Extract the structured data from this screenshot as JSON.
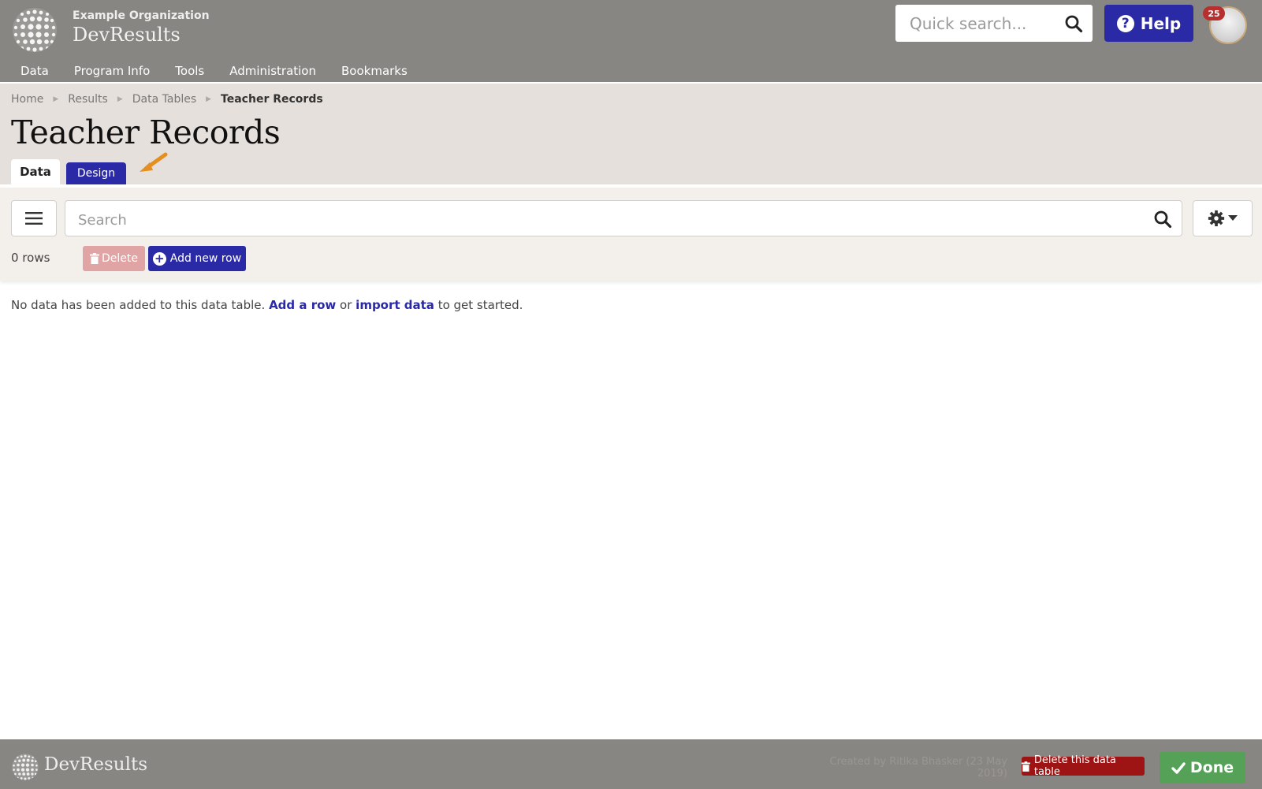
{
  "header": {
    "org_name": "Example Organization",
    "app_name": "DevResults",
    "quick_search": {
      "placeholder": "Quick search...",
      "value": ""
    },
    "help_label": "Help",
    "notification_count": "25"
  },
  "nav": {
    "items": [
      "Data",
      "Program Info",
      "Tools",
      "Administration",
      "Bookmarks"
    ]
  },
  "breadcrumb": {
    "items": [
      "Home",
      "Results",
      "Data Tables"
    ],
    "current": "Teacher Records"
  },
  "page": {
    "title": "Teacher Records",
    "tabs": [
      {
        "label": "Data",
        "active": true
      },
      {
        "label": "Design",
        "active": false
      }
    ]
  },
  "toolbar": {
    "search": {
      "placeholder": "Search",
      "value": ""
    },
    "row_count": "0 rows",
    "delete_label": "Delete",
    "add_row_label": "Add new row"
  },
  "empty_state": {
    "text_before": "No data has been added to this data table. ",
    "add_link": "Add a row",
    "text_middle": " or ",
    "import_link": "import data",
    "text_after": " to get started."
  },
  "footer": {
    "brand": "DevResults",
    "created_by": "Created by Ritika Bhasker (23 May 2019)",
    "delete_table_label": "Delete this data table",
    "done_label": "Done"
  },
  "colors": {
    "header_bg": "#888683",
    "title_band_bg": "#e6e0dc",
    "toolbar_bg": "#f3f0ec",
    "primary": "#2a2aa6",
    "danger": "#9e1313",
    "success": "#56a158",
    "accent_arrow": "#e48f1f"
  },
  "icons": {
    "logo": "globe-dots-icon",
    "quick_search": "search-icon",
    "help": "question-circle-icon",
    "menu": "hamburger-icon",
    "table_search": "search-icon",
    "settings": "gear-icon",
    "delete": "trash-icon",
    "add": "plus-circle-icon",
    "done": "check-icon"
  }
}
